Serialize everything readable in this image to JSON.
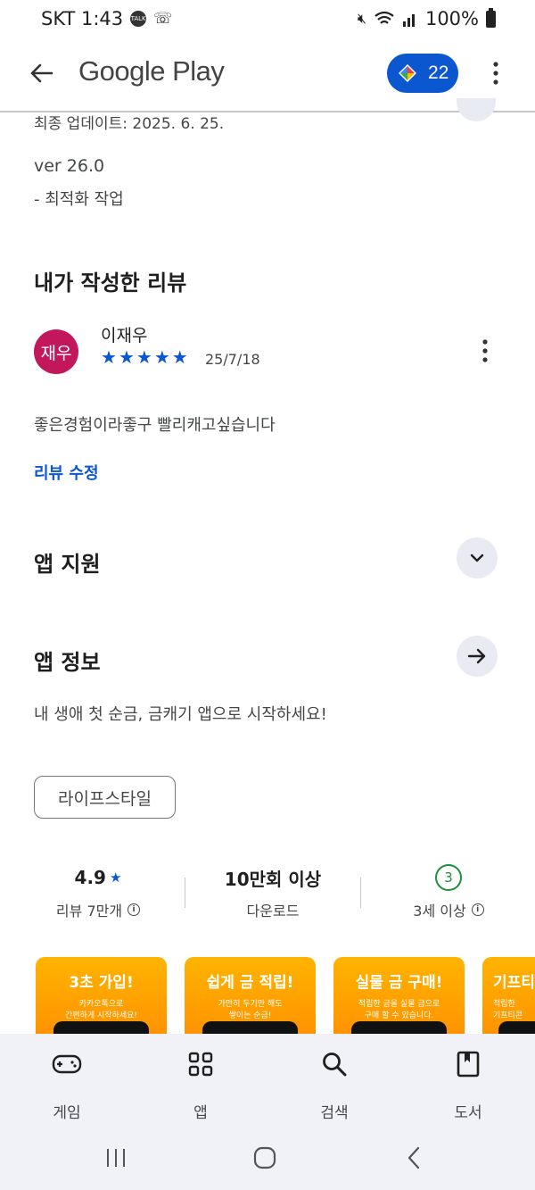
{
  "status_bar": {
    "carrier_time": "SKT 1:43",
    "notif_icons": [
      "talk-icon",
      "phone-icon"
    ],
    "battery": "100%"
  },
  "app_bar": {
    "title": "Google Play",
    "points": "22"
  },
  "whats_new": {
    "last_updated": "최종 업데이트: 2025. 6. 25.",
    "version": "ver 26.0",
    "note": "- 최적화 작업"
  },
  "my_review": {
    "heading": "내가 작성한 리뷰",
    "avatar_text": "재우",
    "reviewer": "이재우",
    "rating": 5,
    "date": "25/7/18",
    "text": "좋은경험이라좋구 빨리캐고싶습니다",
    "edit_link": "리뷰 수정"
  },
  "app_support": {
    "heading": "앱 지원"
  },
  "app_info": {
    "heading": "앱 정보",
    "description": "내 생애 첫 순금, 금캐기 앱으로 시작하세요!",
    "category_chip": "라이프스타일"
  },
  "stats": {
    "rating": "4.9",
    "reviews": "리뷰 7만개",
    "downloads": "10만회 이상",
    "downloads_label": "다운로드",
    "age_badge": "3",
    "age_label": "3세 이상"
  },
  "screenshots": [
    {
      "title": "3초 가입!",
      "sub": "카카오톡으로\n간편하게 시작하세요!"
    },
    {
      "title": "쉽게 금 적립!",
      "sub": "가만히 두기만 해도\n쌓이는 순금!"
    },
    {
      "title": "실물 금 구매!",
      "sub": "적립한 금을 실물 금으로\n구매 할 수 있습니다."
    },
    {
      "title": "기프티",
      "sub": "적립한\n기프티콘"
    }
  ],
  "bottom_nav": {
    "games": "게임",
    "apps": "앱",
    "search": "검색",
    "books": "도서"
  },
  "colors": {
    "accent": "#0b57d0",
    "avatar": "#c2185b",
    "age_green": "#1e8e3e",
    "screenshot_orange": "#ff9f00"
  }
}
